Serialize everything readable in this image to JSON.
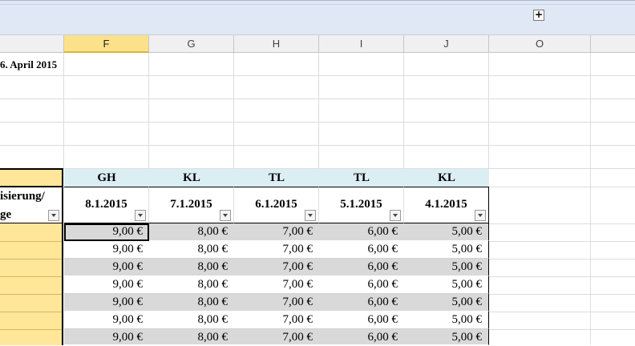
{
  "toolbar": {
    "expand_label": "+"
  },
  "columns": [
    "F",
    "G",
    "H",
    "I",
    "J",
    "O"
  ],
  "header_date": "6. April 2015",
  "header_left": [
    "isierung/",
    "ge"
  ],
  "initials": [
    "GH",
    "KL",
    "TL",
    "TL",
    "KL"
  ],
  "dates": [
    "8.1.2015",
    "7.1.2015",
    "6.1.2015",
    "5.1.2015",
    "4.1.2015"
  ],
  "rows": [
    [
      "9,00 €",
      "8,00 €",
      "7,00 €",
      "6,00 €",
      "5,00 €"
    ],
    [
      "9,00 €",
      "8,00 €",
      "7,00 €",
      "6,00 €",
      "5,00 €"
    ],
    [
      "9,00 €",
      "8,00 €",
      "7,00 €",
      "6,00 €",
      "5,00 €"
    ],
    [
      "9,00 €",
      "8,00 €",
      "7,00 €",
      "6,00 €",
      "5,00 €"
    ],
    [
      "9,00 €",
      "8,00 €",
      "7,00 €",
      "6,00 €",
      "5,00 €"
    ],
    [
      "9,00 €",
      "8,00 €",
      "7,00 €",
      "6,00 €",
      "5,00 €"
    ],
    [
      "9,00 €",
      "8,00 €",
      "7,00 €",
      "6,00 €",
      "5,00 €"
    ]
  ],
  "colors": {
    "highlight_yellow": "#ffe699",
    "header_blue": "#dbeef4",
    "row_shade": "#d9d9d9",
    "selected_col": "#fbe18a"
  }
}
